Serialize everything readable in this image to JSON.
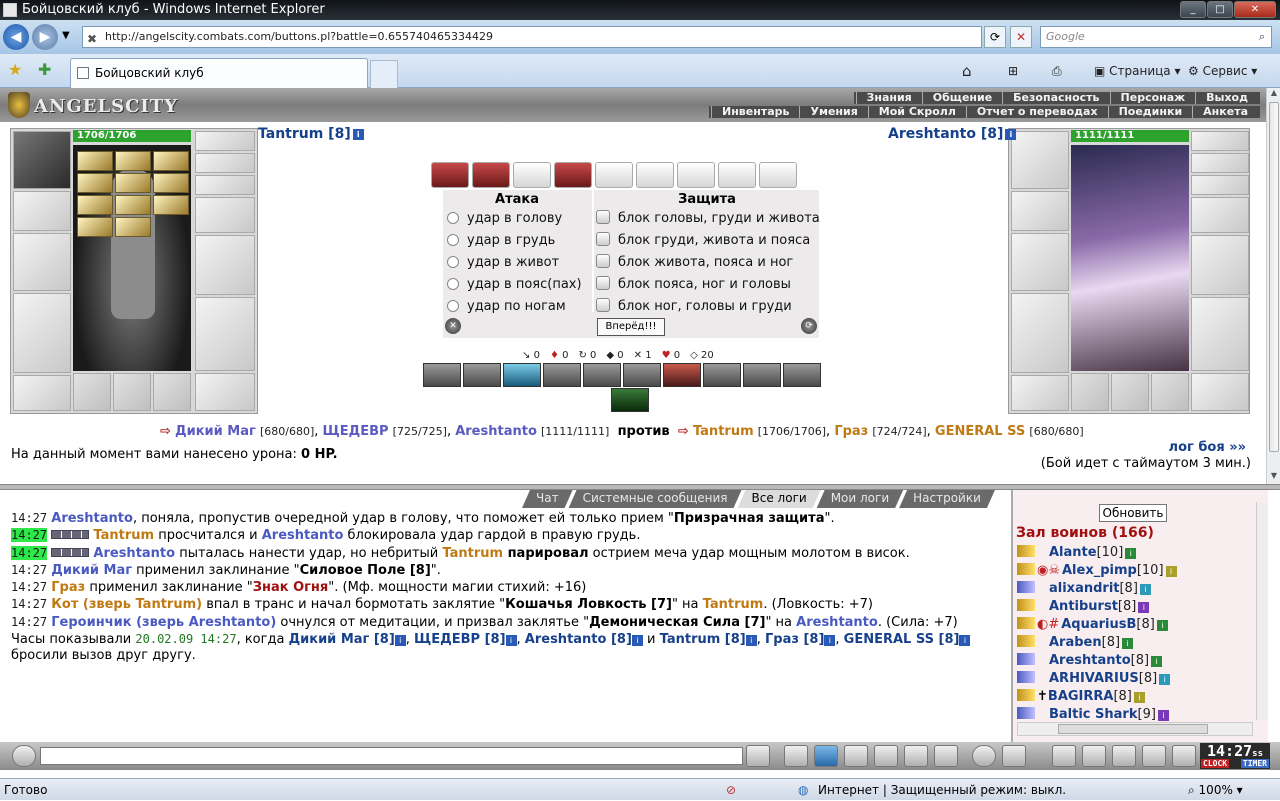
{
  "window": {
    "title": "Бойцовский клуб - Windows Internet Explorer",
    "min": "_",
    "max": "□",
    "close": "✕"
  },
  "address": {
    "url": "http://angelscity.combats.com/buttons.pl?battle=0.655740465334429",
    "search_placeholder": "Google"
  },
  "tabs": [
    {
      "label": "Бойцовский клуб"
    }
  ],
  "toolbar": {
    "page": "Страница",
    "service": "Сервис"
  },
  "game": {
    "logo": "ANGELSCITY",
    "menu_top": [
      "Знания",
      "Общение",
      "Безопасность",
      "Персонаж",
      "Выход"
    ],
    "menu_bottom": [
      "Инвентарь",
      "Умения",
      "Мой Скролл",
      "Отчет о переводах",
      "Поединки",
      "Анкета"
    ]
  },
  "player_left": {
    "name": "Tantrum [8]",
    "hp": "1706/1706"
  },
  "player_right": {
    "name": "Areshtanto [8]",
    "hp": "1111/1111"
  },
  "combat": {
    "attack_header": "Атака",
    "defense_header": "Защита",
    "attacks": [
      "удар в голову",
      "удар в грудь",
      "удар в живот",
      "удар в пояс(пах)",
      "удар по ногам"
    ],
    "defenses": [
      "блок головы, груди и живота",
      "блок груди, живота и пояса",
      "блок живота, пояса и ног",
      "блок пояса, ног и головы",
      "блок ног, головы и груди"
    ],
    "go_button": "Вперёд!!!",
    "stats": [
      "0",
      "0",
      "0",
      "0",
      "1",
      "0",
      "20"
    ]
  },
  "versus": {
    "team_a": [
      {
        "name": "Дикий Маг",
        "hp": "[680/680]"
      },
      {
        "name": "ЩЕДЕВР",
        "hp": "[725/725]"
      },
      {
        "name": "Areshtanto",
        "hp": "[1111/1111]"
      }
    ],
    "vs_word": "против",
    "team_b": [
      {
        "name": "Tantrum",
        "hp": "[1706/1706]"
      },
      {
        "name": "Граз",
        "hp": "[724/724]"
      },
      {
        "name": "GENERAL SS",
        "hp": "[680/680]"
      }
    ]
  },
  "damage": {
    "text": "На данный момент вами нанесено урона:",
    "value": "0 HP."
  },
  "battle_log_link": "лог боя »»",
  "timeout_text": "(Бой идет с таймаутом 3 мин.)",
  "chat_tabs": [
    "Чат",
    "Системные сообщения",
    "Все логи",
    "Мои логи",
    "Настройки"
  ],
  "chat": [
    {
      "time": "14:27",
      "a": "Areshtanto",
      "t1": ", поняла, пропустив очередной удар в голову, что поможет ей только прием \"",
      "b": "Призрачная защита",
      "t2": "\"."
    },
    {
      "time": "14:27",
      "a": "Tantrum",
      "t1": " просчитался и ",
      "b": "Areshtanto",
      "t2": " блокировала удар гардой в правую грудь."
    },
    {
      "time": "14:27",
      "a": "Areshtanto",
      "t1": " пыталась нанести удар, но небритый ",
      "b": "Tantrum",
      "c": " парировал",
      "t2": " острием меча удар мощным молотом в висок."
    },
    {
      "time": "14:27",
      "a": "Дикий Маг",
      "t1": " применил заклинание \"",
      "b": "Силовое Поле [8]",
      "t2": "\"."
    },
    {
      "time": "14:27",
      "a": "Граз",
      "t1": " применил заклинание \"",
      "b": "Знак Огня",
      "t2": "\". (Мф. мощности магии стихий: +16)"
    },
    {
      "time": "14:27",
      "a": "Кот (зверь Tantrum)",
      "t1": " впал в транс и начал бормотать заклятие \"",
      "b": "Кошачья Ловкость [7]",
      "t2": "\" на ",
      "c": "Tantrum",
      "t3": ". (Ловкость: +7)"
    },
    {
      "time": "14:27",
      "a": "Героинчик (зверь Areshtanto)",
      "t1": " очнулся от медитации, и призвал заклятье \"",
      "b": "Демоническая Сила [7]",
      "t2": "\" на ",
      "c": "Areshtanto",
      "t3": ". (Сила: +7)"
    }
  ],
  "chat_final": {
    "prefix": "Часы показывали",
    "datetime": "20.02.09 14:27",
    "mid": ", когда",
    "names": [
      "Дикий Маг [8]",
      "ЩЕДЕВР [8]",
      "Areshtanto [8]",
      "Tantrum [8]",
      "Граз [8]",
      "GENERAL SS [8]"
    ],
    "and": "и",
    "end": "бросили вызов друг другу."
  },
  "room": {
    "refresh": "Обновить",
    "title": "Зал воинов (166)",
    "players": [
      {
        "name": "Alante",
        "level": "[10]"
      },
      {
        "name": "Alex_pimp",
        "level": "[10]"
      },
      {
        "name": "alixandrit",
        "level": "[8]"
      },
      {
        "name": "Antiburst",
        "level": "[8]"
      },
      {
        "name": "AquariusB",
        "level": "[8]"
      },
      {
        "name": "Araben",
        "level": "[8]"
      },
      {
        "name": "Areshtanto",
        "level": "[8]"
      },
      {
        "name": "ARHIVARIUS",
        "level": "[8]"
      },
      {
        "name": "BAGIRRA",
        "level": "[8]"
      },
      {
        "name": "Baltic Shark",
        "level": "[9]"
      }
    ]
  },
  "clock": {
    "time": "14:27",
    "ss": "ss",
    "clock": "CLOCK",
    "timer": "TIMER"
  },
  "status": {
    "ready": "Готово",
    "zone": "Интернет | Защищенный режим: выкл.",
    "zoom": "100%"
  }
}
